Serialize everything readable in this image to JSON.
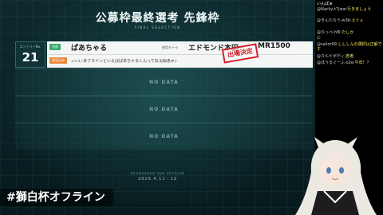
{
  "header": {
    "title": "公募枠最終選考 先鋒枠",
    "subtitle": "FINAL SELECTION"
  },
  "entry": {
    "entry_label": "エントリーNo.",
    "entry_number": "21",
    "row1_tag": "名前",
    "row1_name": "ぱあちゃる",
    "row1_label2": "使用キャラ",
    "row1_character": "エドモンド本田",
    "row1_label3": "ランク",
    "row1_rank": "MR1500",
    "stamp": "出場決定",
    "row2_tag": "意気込み",
    "row2_label": "エキストラ",
    "row2_text": "オフラインといえばぱあちゃるくんって伝えなきゃ",
    "row2_label2": "エキストラ"
  },
  "slots": [
    "NO DATA",
    "NO DATA",
    "NO DATA"
  ],
  "footer": {
    "sponsor": "SPONSORED FAN SETTLED",
    "date": "2026.4.11・12"
  },
  "hashtag": "#獅白杯オフライン",
  "chat": [
    {
      "user": "",
      "text": "いんぱぁ"
    },
    {
      "user": "@Nacky-t7jww:",
      "text": "行きましょう"
    },
    {
      "user": "@きんたろう-w3b:",
      "text": "えぐぇ"
    },
    {
      "user": "@ひっぺ-h8l:",
      "text": "たしか"
    },
    {
      "user": "",
      "text": "に"
    },
    {
      "user": "@sailor99:",
      "text": "しししんの選択は正解です"
    },
    {
      "user": "@カルビポディ:",
      "text": "若者"
    },
    {
      "user": "@ほうるぐーふ-o2e:",
      "text": "午年！？"
    }
  ],
  "colors": {
    "accent": "#39a86b",
    "orange": "#e9893b",
    "stamp": "#d11f2b",
    "background": "#0b1e22"
  }
}
